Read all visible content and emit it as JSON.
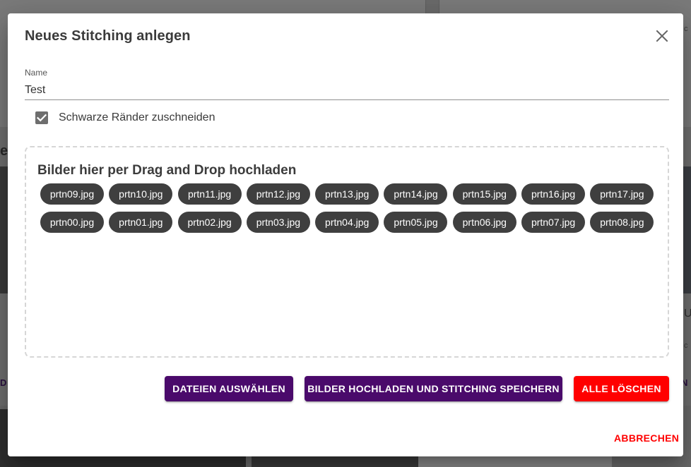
{
  "dialog": {
    "title": "Neues Stitching anlegen",
    "close_icon": "close-icon"
  },
  "name_field": {
    "label": "Name",
    "value": "Test"
  },
  "crop_checkbox": {
    "label": "Schwarze Ränder zuschneiden",
    "checked": true
  },
  "dropzone": {
    "title": "Bilder hier per Drag and Drop hochladen",
    "files": [
      "prtn09.jpg",
      "prtn10.jpg",
      "prtn11.jpg",
      "prtn12.jpg",
      "prtn13.jpg",
      "prtn14.jpg",
      "prtn15.jpg",
      "prtn16.jpg",
      "prtn17.jpg",
      "prtn00.jpg",
      "prtn01.jpg",
      "prtn02.jpg",
      "prtn03.jpg",
      "prtn04.jpg",
      "prtn05.jpg",
      "prtn06.jpg",
      "prtn07.jpg",
      "prtn08.jpg"
    ]
  },
  "actions": {
    "select_files": "DATEIEN AUSWÄHLEN",
    "upload_and_save": "BILDER HOCHLADEN UND STITCHING SPEICHERN",
    "delete_all": "ALLE LÖSCHEN",
    "cancel": "ABBRECHEN"
  },
  "colors": {
    "primary": "#4a0a6b",
    "warn": "#ff0000",
    "chip": "#3f3f3f",
    "checkbox": "#6e6e6e"
  }
}
